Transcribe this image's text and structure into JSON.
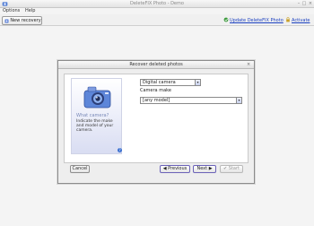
{
  "window": {
    "title": "DeleteFIX Photo - Demo",
    "minimize": "–",
    "maximize": "□",
    "close": "×"
  },
  "menu": [
    {
      "label": "Options"
    },
    {
      "label": "Help"
    }
  ],
  "toolbar": {
    "new_recovery_label": "New recovery",
    "update_link": "Update DeleteFIX Photo",
    "activate_link": "Activate"
  },
  "dialog": {
    "title": "Recover deleted photos",
    "close": "×",
    "side": {
      "heading": "What camera?",
      "description": "Indicate the make and model of your camera.",
      "help": "?"
    },
    "camera_type": {
      "value": "Digital camera",
      "arrow": "▾"
    },
    "camera_make": {
      "label": "Camera make",
      "value": "[any model]",
      "arrow": "▾"
    },
    "buttons": {
      "cancel": "Cancel",
      "previous": "◀  Previous",
      "next": "Next  ▶",
      "start": "✔ Start"
    }
  },
  "colors": {
    "accent": "#6b62b8",
    "link": "#1a3fc0",
    "panel_gradient_end": "#d9ddf2"
  }
}
